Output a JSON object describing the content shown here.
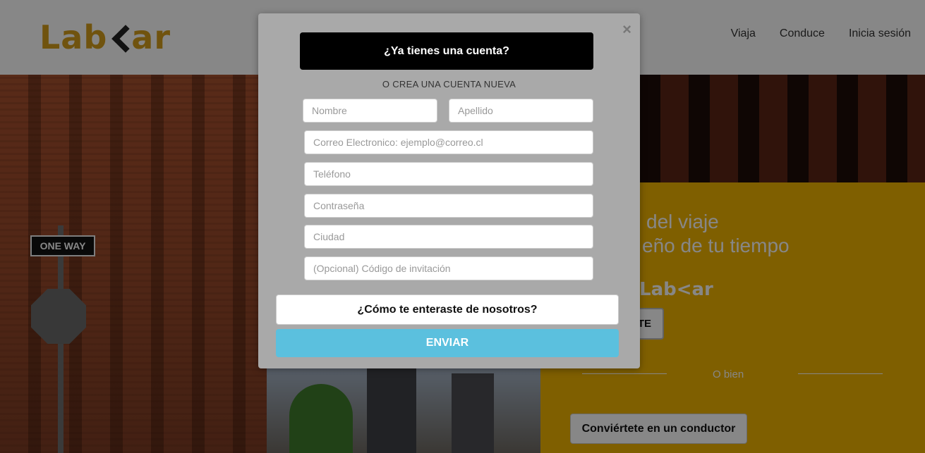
{
  "header": {
    "logo_text_left": "Lab",
    "logo_text_right": "ar",
    "nav": [
      "Viaja",
      "Conduce",
      "Inicia sesión"
    ]
  },
  "hero": {
    "sign_text": "ONE WAY",
    "title_line1": "del viaje",
    "title_line2": "eño de tu tiempo",
    "mini_logo": "Lab<ar",
    "primary_button_label": "TE",
    "divider_text": "O bien",
    "driver_button_label": "Conviértete en un conductor"
  },
  "modal": {
    "close_label": "×",
    "login_button_label": "¿Ya tienes una cuenta?",
    "subtitle": "O CREA UNA CUENTA NUEVA",
    "fields": {
      "first_name_placeholder": "Nombre",
      "last_name_placeholder": "Apellido",
      "email_placeholder": "Correo Electronico: ejemplo@correo.cl",
      "phone_placeholder": "Teléfono",
      "password_placeholder": "Contraseña",
      "city_placeholder": "Ciudad",
      "invite_placeholder": "(Opcional) Código de invitación"
    },
    "survey_button_label": "¿Cómo te enteraste de nosotros?",
    "submit_button_label": "ENVIAR"
  },
  "colors": {
    "brand": "#d39e1b",
    "submit": "#5bc0de",
    "hero_panel": "#f0b400",
    "modal_bg": "#a9a9a9"
  }
}
